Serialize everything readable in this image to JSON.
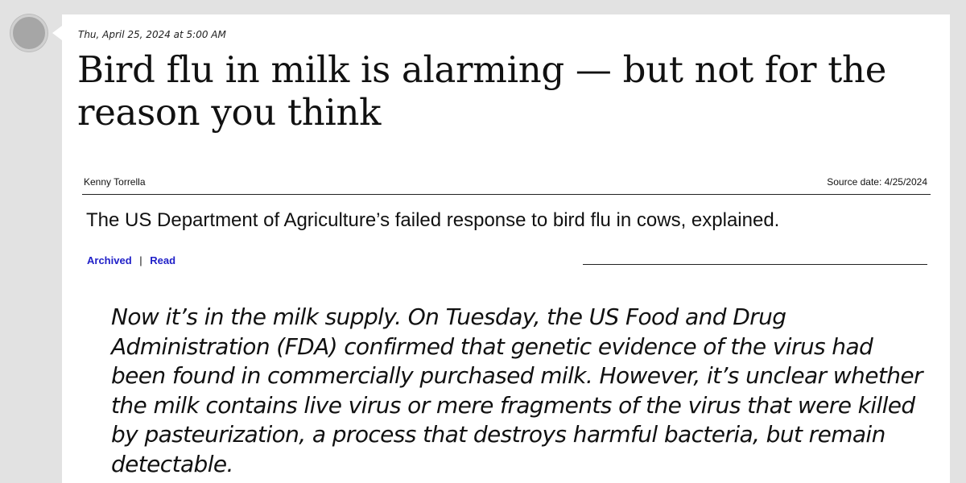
{
  "post": {
    "timestamp": "Thu, April 25, 2024 at 5:00 AM",
    "headline": "Bird flu in milk is alarming — but not for the reason you think",
    "author": "Kenny Torrella",
    "source_date": "Source date: 4/25/2024",
    "subheadline": "The US Department of Agriculture’s failed response to bird flu in cows, explained.",
    "links": {
      "archived_label": "Archived",
      "separator": "|",
      "read_label": "Read"
    },
    "quote": "Now it’s in the milk supply. On Tuesday, the US Food and Drug Administration (FDA) confirmed that genetic evidence of the virus had been found in commercially purchased milk. However, it’s unclear whether the milk contains live virus or mere fragments of the virus that were killed by pasteurization, a process that destroys harmful bacteria, but remain detectable."
  },
  "colors": {
    "page_background": "#e2e2e2",
    "card_background": "#ffffff",
    "link": "#2020c8",
    "text": "#111111"
  },
  "icons": {
    "avatar": "avatar-circle"
  }
}
